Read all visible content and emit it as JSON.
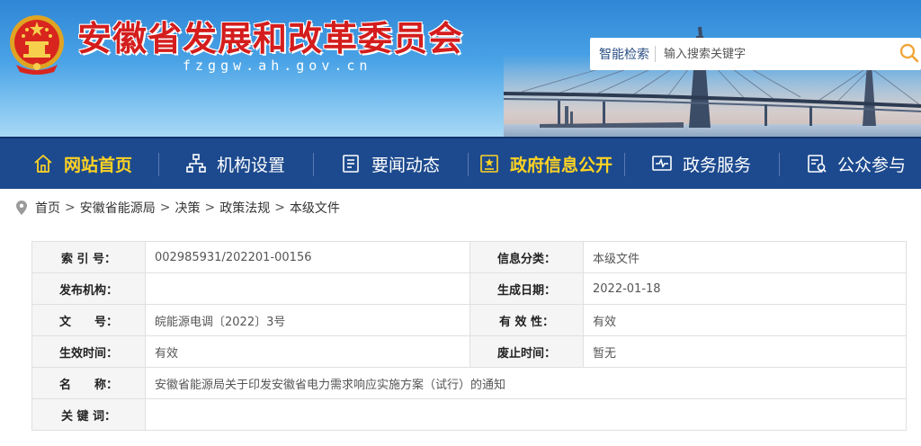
{
  "header": {
    "site_title": "安徽省发展和改革委员会",
    "domain": "fzggw.ah.gov.cn",
    "search": {
      "label": "智能检索",
      "placeholder": "输入搜索关键字"
    },
    "emblem_icon": "national-emblem-icon"
  },
  "nav": {
    "items": [
      {
        "label": "网站首页",
        "icon": "home-icon",
        "active": true
      },
      {
        "label": "机构设置",
        "icon": "org-chart-icon",
        "active": false
      },
      {
        "label": "要闻动态",
        "icon": "document-icon",
        "active": false
      },
      {
        "label": "政府信息公开",
        "icon": "info-disclosure-icon",
        "active": false
      },
      {
        "label": "政务服务",
        "icon": "service-icon",
        "active": false
      },
      {
        "label": "公众参与",
        "icon": "participation-icon",
        "active": false
      }
    ],
    "active_color": "#ffd323",
    "background": "#1d4a8e"
  },
  "breadcrumb": {
    "icon": "location-pin-icon",
    "separator": ">",
    "items": [
      "首页",
      "安徽省能源局",
      "决策",
      "政策法规",
      "本级文件"
    ]
  },
  "info_table": {
    "rows": [
      {
        "k1": "索 引 号：",
        "v1": "002985931/202201-00156",
        "k2": "信息分类：",
        "v2": "本级文件"
      },
      {
        "k1": "发布机构：",
        "v1": "",
        "k2": "生成日期：",
        "v2": "2022-01-18"
      },
      {
        "k1": "文　　号：",
        "v1": "皖能源电调〔2022〕3号",
        "k2": "有 效 性：",
        "v2": "有效"
      },
      {
        "k1": "生效时间：",
        "v1": "有效",
        "k2": "废止时间：",
        "v2": "暂无"
      }
    ],
    "name_label": "名　　称：",
    "name_value": "安徽省能源局关于印发安徽省电力需求响应实施方案（试行）的通知",
    "keywords_label": "关 键 词：",
    "keywords_value": ""
  }
}
